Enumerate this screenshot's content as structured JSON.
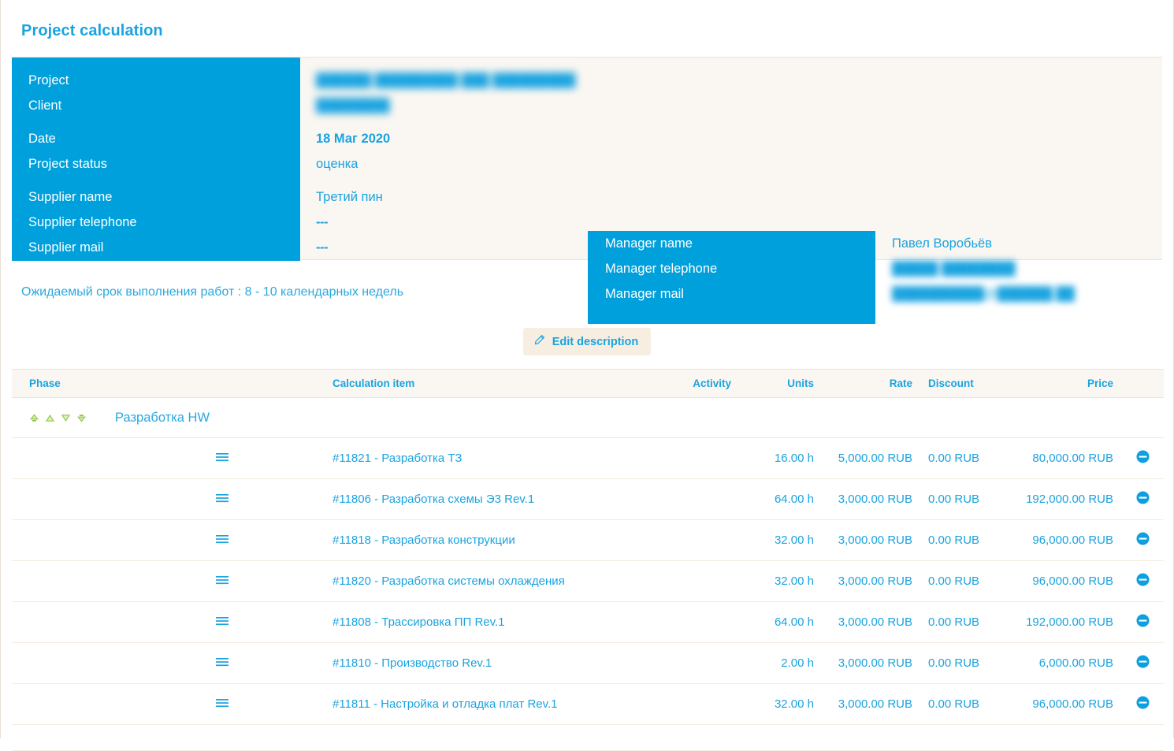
{
  "page_title": "Project calculation",
  "colors": {
    "brand_blue": "#00a0dc",
    "text_blue": "#1aa3e0",
    "panel_beige": "#faf7f2",
    "button_beige": "#f7eee2",
    "border_beige": "#ece3d6",
    "sort_green": "#8ec641"
  },
  "info_panel": {
    "labels": {
      "project": "Project",
      "client": "Client",
      "date": "Date",
      "project_status": "Project status",
      "supplier_name": "Supplier name",
      "supplier_telephone": "Supplier telephone",
      "supplier_mail": "Supplier mail",
      "manager_name": "Manager name",
      "manager_telephone": "Manager telephone",
      "manager_mail": "Manager mail"
    },
    "values": {
      "project": "██████ █████████ ███ █████████ ████████",
      "client": "",
      "date": "18 Маг 2020",
      "project_status": "оценка",
      "supplier_name": "Третий пин",
      "supplier_telephone": "---",
      "supplier_mail": "---",
      "manager_name": "Павел Воробьёв",
      "manager_telephone": "█████ ████████",
      "manager_mail": "██████████@██████.██"
    }
  },
  "description": "Ожидаемый срок выполнения работ : 8 - 10 календарных недель",
  "edit_button": {
    "label": "Edit description",
    "icon": "pencil-icon"
  },
  "table": {
    "headers": {
      "phase": "Phase",
      "calculation_item": "Calculation item",
      "activity": "Activity",
      "units": "Units",
      "rate": "Rate",
      "discount": "Discount",
      "price": "Price"
    },
    "phase_row": {
      "name": "Разработка HW",
      "icons": [
        "move-to-top-icon",
        "move-up-icon",
        "move-down-icon",
        "move-to-bottom-icon"
      ]
    },
    "rows": [
      {
        "item": "#11821 - Разработка ТЗ",
        "activity": "",
        "units": "16.00 h",
        "rate": "5,000.00 RUB",
        "discount": "0.00 RUB",
        "price": "80,000.00 RUB"
      },
      {
        "item": "#11806 - Разработка схемы Э3 Rev.1",
        "activity": "",
        "units": "64.00 h",
        "rate": "3,000.00 RUB",
        "discount": "0.00 RUB",
        "price": "192,000.00 RUB"
      },
      {
        "item": "#11818 - Разработка конструкции",
        "activity": "",
        "units": "32.00 h",
        "rate": "3,000.00 RUB",
        "discount": "0.00 RUB",
        "price": "96,000.00 RUB"
      },
      {
        "item": "#11820 - Разработка системы охлаждения",
        "activity": "",
        "units": "32.00 h",
        "rate": "3,000.00 RUB",
        "discount": "0.00 RUB",
        "price": "96,000.00 RUB"
      },
      {
        "item": "#11808 - Трассировка ПП Rev.1",
        "activity": "",
        "units": "64.00 h",
        "rate": "3,000.00 RUB",
        "discount": "0.00 RUB",
        "price": "192,000.00 RUB"
      },
      {
        "item": "#11810 - Производство Rev.1",
        "activity": "",
        "units": "2.00 h",
        "rate": "3,000.00 RUB",
        "discount": "0.00 RUB",
        "price": "6,000.00 RUB"
      },
      {
        "item": "#11811 - Настройка и отладка плат Rev.1",
        "activity": "",
        "units": "32.00 h",
        "rate": "3,000.00 RUB",
        "discount": "0.00 RUB",
        "price": "96,000.00 RUB"
      }
    ],
    "row_icons": {
      "drag": "drag-handle-icon",
      "delete": "remove-circle-icon"
    }
  }
}
